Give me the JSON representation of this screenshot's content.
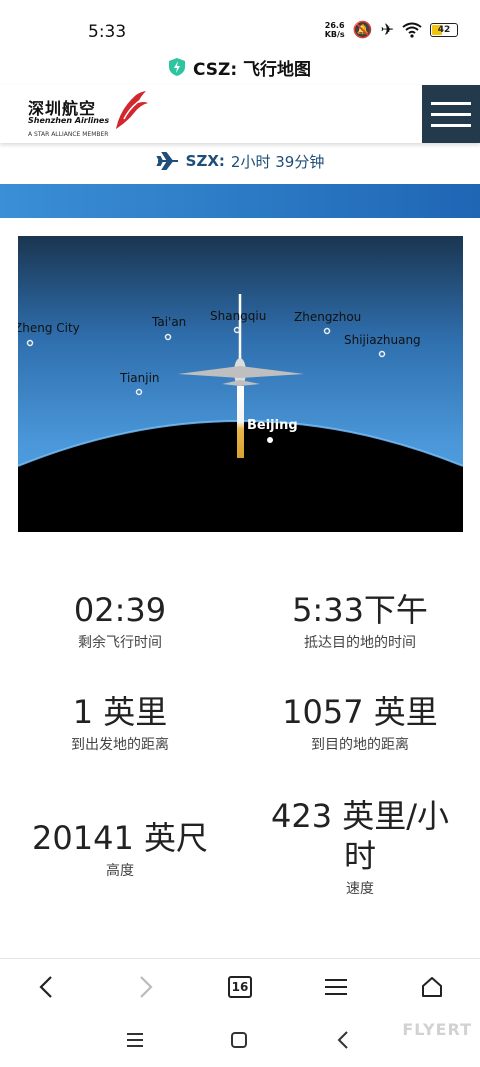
{
  "status_bar": {
    "time": "5:33",
    "net_speed_value": "26.6",
    "net_speed_unit": "KB/s",
    "battery": "42"
  },
  "page": {
    "title": "CSZ: 飞行地图"
  },
  "header": {
    "logo_cn": "深圳航空",
    "logo_en": "Shenzhen Airlines",
    "logo_alliance": "A STAR ALLIANCE MEMBER"
  },
  "destination": {
    "code": "SZX:",
    "remaining": "2小时 39分钟"
  },
  "map": {
    "cities": [
      {
        "name": "Zheng City"
      },
      {
        "name": "Tai'an"
      },
      {
        "name": "Shangqiu"
      },
      {
        "name": "Zhengzhou"
      },
      {
        "name": "Shijiazhuang"
      },
      {
        "name": "Tianjin"
      },
      {
        "name": "Beijing"
      }
    ]
  },
  "stats": {
    "time_remaining": {
      "value": "02:39",
      "label": "剩余飞行时间"
    },
    "arrival_time": {
      "value": "5:33下午",
      "label": "抵达目的地的时间"
    },
    "distance_from_origin": {
      "value": "1 英里",
      "label": "到出发地的距离"
    },
    "distance_to_destination": {
      "value": "1057 英里",
      "label": "到目的地的距离"
    },
    "altitude": {
      "value": "20141 英尺",
      "label": "高度"
    },
    "speed": {
      "value": "423 英里/小时",
      "label": "速度"
    }
  },
  "browser_nav": {
    "tab_count": "16"
  },
  "watermark": "FLYERT"
}
